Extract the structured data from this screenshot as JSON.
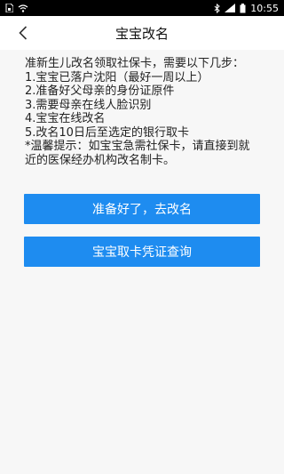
{
  "status_bar": {
    "time": "10:55",
    "icons": [
      "sim-card-icon",
      "wifi-icon",
      "bluetooth-icon",
      "signal-icon",
      "battery-icon"
    ]
  },
  "header": {
    "title": "宝宝改名"
  },
  "main": {
    "intro": "准新生儿改名领取社保卡，需要以下几步：",
    "steps": [
      "1.宝宝已落户沈阳（最好一周以上）",
      "2.准备好父母亲的身份证原件",
      "3.需要母亲在线人脸识别",
      "4.宝宝在线改名",
      "5.改名10日后至选定的银行取卡"
    ],
    "tip": "*温馨提示：如宝宝急需社保卡，请直接到就近的医保经办机构改名制卡。"
  },
  "buttons": {
    "ready_label": "准备好了，去改名",
    "query_label": "宝宝取卡凭证查询"
  },
  "colors": {
    "accent": "#1e8cf0",
    "background": "#f7f7f7",
    "status_bar": "#000000"
  }
}
